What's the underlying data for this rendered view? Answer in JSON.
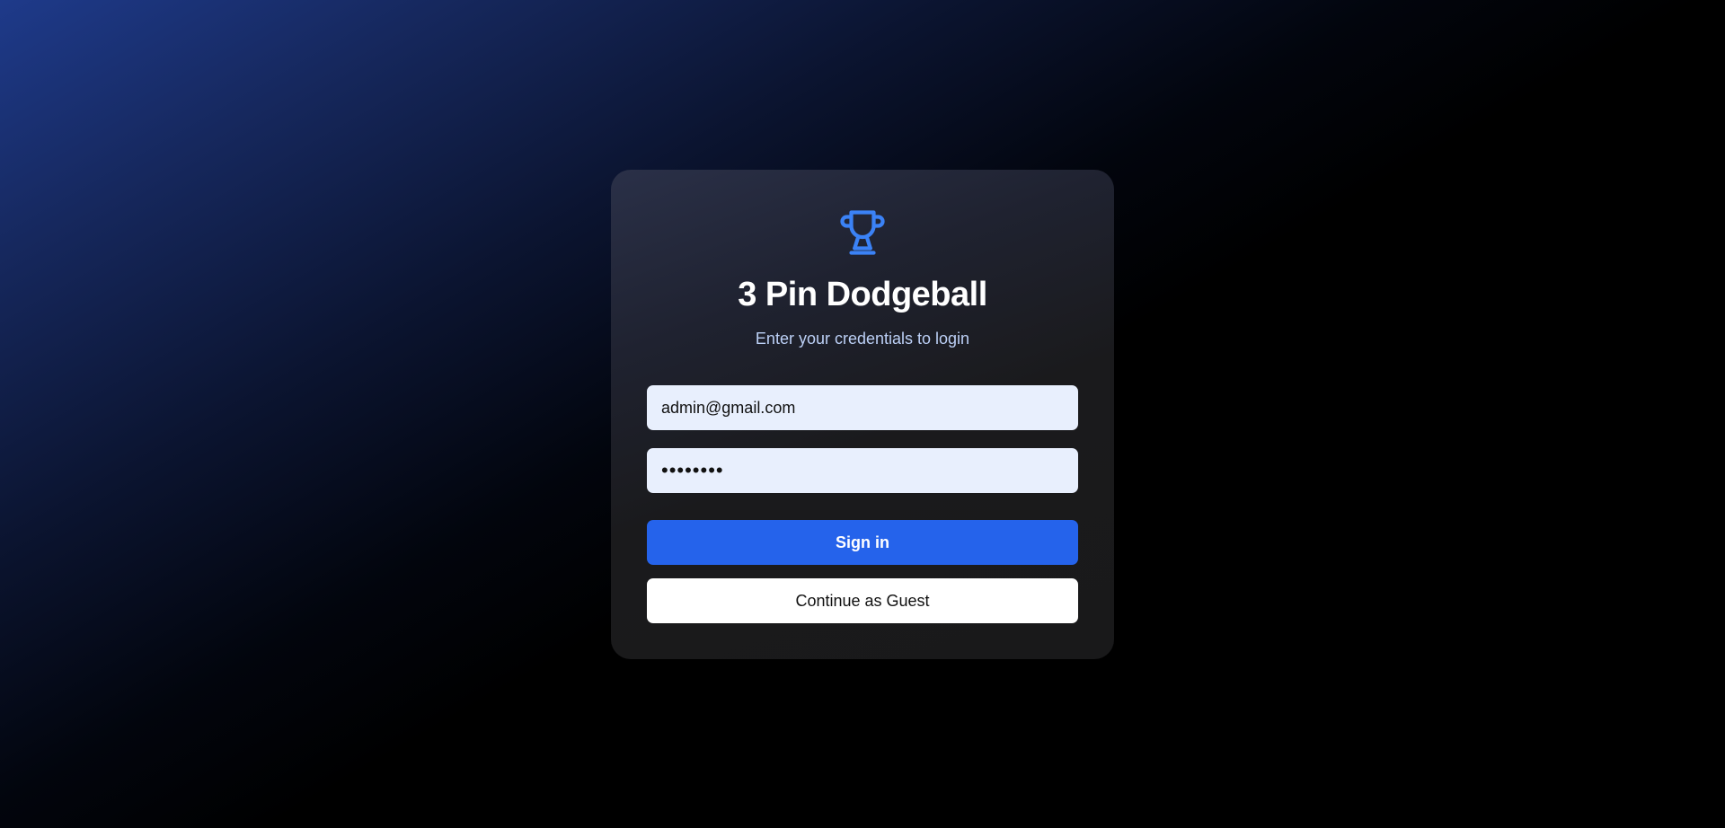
{
  "app": {
    "title": "3 Pin Dodgeball",
    "subtitle": "Enter your credentials to login",
    "logo_icon": "trophy-icon"
  },
  "form": {
    "email_value": "admin@gmail.com",
    "password_value": "password",
    "sign_in_label": "Sign in",
    "guest_label": "Continue as Guest"
  },
  "colors": {
    "accent": "#2563eb",
    "logo": "#3b82f6",
    "subtitle": "#bcd0f6",
    "input_bg": "#e8effd"
  }
}
